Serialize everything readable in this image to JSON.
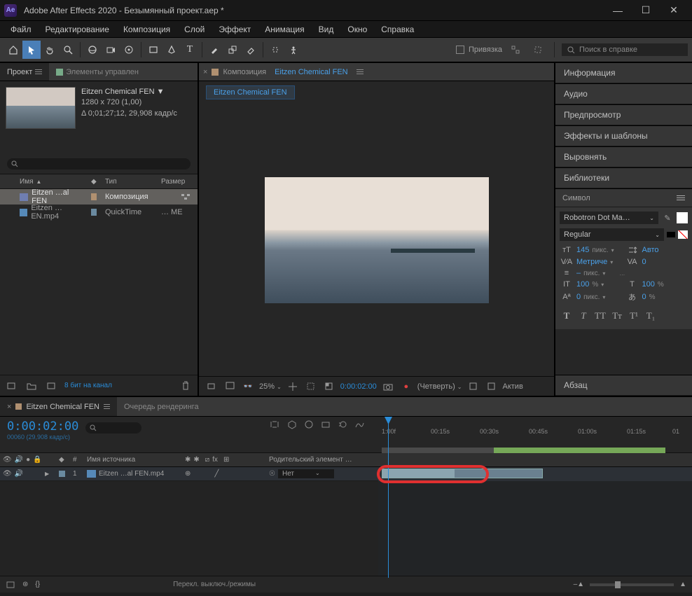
{
  "titlebar": {
    "app": "Adobe After Effects 2020 - Безымянный проект.aep *"
  },
  "menu": [
    "Файл",
    "Редактирование",
    "Композиция",
    "Слой",
    "Эффект",
    "Анимация",
    "Вид",
    "Окно",
    "Справка"
  ],
  "toolbar": {
    "snap_label": "Привязка",
    "search_placeholder": "Поиск в справке"
  },
  "project": {
    "tab_label": "Проект",
    "second_tab": "Элементы управлен",
    "sel_name": "Eitzen Chemical FEN ▼",
    "sel_dims": "1280 x 720 (1,00)",
    "sel_dur": "Δ 0;01;27;12, 29,908 кадр/с",
    "search_placeholder": "",
    "cols": {
      "name": "Имя",
      "type": "Тип",
      "size": "Размер"
    },
    "items": [
      {
        "name": "Eitzen …al FEN",
        "type": "Композиция",
        "size": ""
      },
      {
        "name": "Eitzen …EN.mp4",
        "type": "QuickTime",
        "size": "… ME"
      }
    ],
    "foot_bits": "8 бит на канал"
  },
  "viewer": {
    "prefix": "Композиция",
    "comp_name": "Eitzen Chemical FEN",
    "tab_name": "Eitzen Chemical FEN",
    "zoom": "25%",
    "time": "0:00:02:00",
    "quality": "(Четверть)",
    "active": "Актив"
  },
  "panels": {
    "info": "Информация",
    "audio": "Аудио",
    "preview": "Предпросмотр",
    "effects": "Эффекты и шаблоны",
    "align": "Выровнять",
    "libs": "Библиотеки",
    "char": "Символ",
    "para": "Абзац"
  },
  "char": {
    "font": "Robotron Dot Ma…",
    "style": "Regular",
    "size": "145",
    "size_unit": "пикс.",
    "leading": "Авто",
    "kerning": "Метриче",
    "tracking": "0",
    "stroke": "–",
    "stroke_unit": "пикс.",
    "vscale": "100",
    "hscale": "100",
    "pct": "%",
    "baseline": "0",
    "baseline_unit": "пикс.",
    "tsume": "0"
  },
  "timeline": {
    "tab": "Eitzen Chemical FEN",
    "render_tab": "Очередь рендеринга",
    "timecode": "0:00:02:00",
    "timecode_sub": "00060 (29,908 кадр/с)",
    "cols": {
      "eye": "",
      "lock": "",
      "idx": "#",
      "src": "Имя источника",
      "sw": "",
      "parent": "Родительский элемент …"
    },
    "layers": [
      {
        "idx": "1",
        "name": "Eitzen …al FEN.mp4",
        "parent": "Нет"
      }
    ],
    "ruler": [
      "1:00f",
      "00:15s",
      "00:30s",
      "00:45s",
      "01:00s",
      "01:15s",
      "01"
    ],
    "foot": "Перекл. выключ./режимы"
  }
}
